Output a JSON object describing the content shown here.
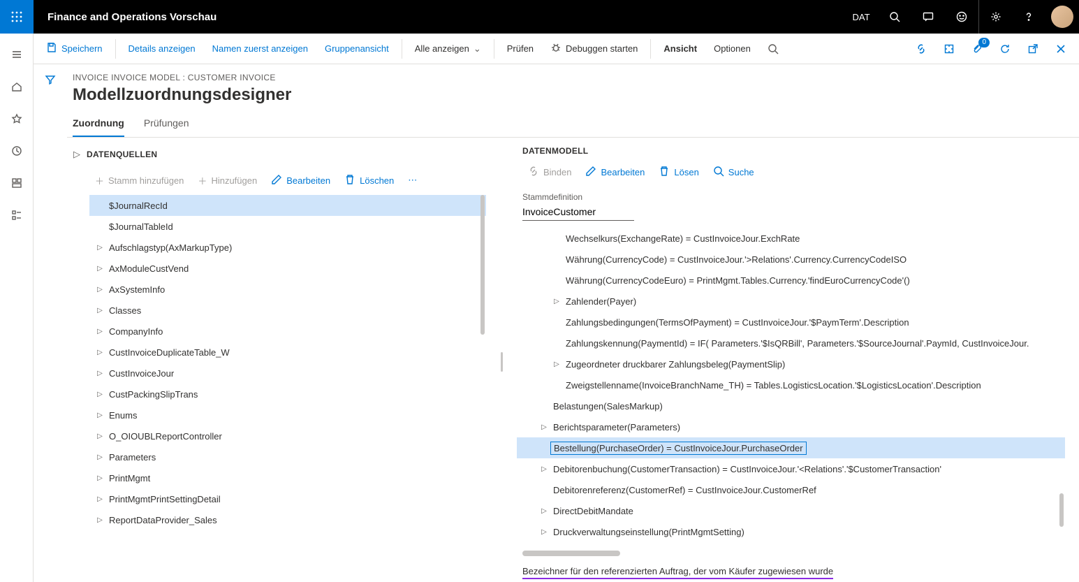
{
  "topbar": {
    "app_title": "Finance and Operations Vorschau",
    "company": "DAT"
  },
  "cmdbar": {
    "save": "Speichern",
    "details": "Details anzeigen",
    "names_first": "Namen zuerst anzeigen",
    "group_view": "Gruppenansicht",
    "show_all": "Alle anzeigen",
    "check": "Prüfen",
    "debug": "Debuggen starten",
    "view": "Ansicht",
    "options": "Optionen",
    "badge_count": "0"
  },
  "page": {
    "breadcrumb": "INVOICE INVOICE MODEL : CUSTOMER INVOICE",
    "title": "Modellzuordnungsdesigner",
    "tab_map": "Zuordnung",
    "tab_check": "Prüfungen"
  },
  "ds": {
    "header": "DATENQUELLEN",
    "add_root": "Stamm hinzufügen",
    "add": "Hinzufügen",
    "edit": "Bearbeiten",
    "delete": "Löschen",
    "items": [
      {
        "label": "$JournalRecId",
        "exp": false,
        "sel": true
      },
      {
        "label": "$JournalTableId",
        "exp": false,
        "sel": false
      },
      {
        "label": "Aufschlagstyp(AxMarkupType)",
        "exp": true,
        "sel": false
      },
      {
        "label": "AxModuleCustVend",
        "exp": true,
        "sel": false
      },
      {
        "label": "AxSystemInfo",
        "exp": true,
        "sel": false
      },
      {
        "label": "Classes",
        "exp": true,
        "sel": false
      },
      {
        "label": "CompanyInfo",
        "exp": true,
        "sel": false
      },
      {
        "label": "CustInvoiceDuplicateTable_W",
        "exp": true,
        "sel": false
      },
      {
        "label": "CustInvoiceJour",
        "exp": true,
        "sel": false
      },
      {
        "label": "CustPackingSlipTrans",
        "exp": true,
        "sel": false
      },
      {
        "label": "Enums",
        "exp": true,
        "sel": false
      },
      {
        "label": "O_OIOUBLReportController",
        "exp": true,
        "sel": false
      },
      {
        "label": "Parameters",
        "exp": true,
        "sel": false
      },
      {
        "label": "PrintMgmt",
        "exp": true,
        "sel": false
      },
      {
        "label": "PrintMgmtPrintSettingDetail",
        "exp": true,
        "sel": false
      },
      {
        "label": "ReportDataProvider_Sales",
        "exp": true,
        "sel": false
      }
    ]
  },
  "dm": {
    "header": "DATENMODELL",
    "bind": "Binden",
    "edit": "Bearbeiten",
    "delete": "Lösen",
    "search": "Suche",
    "root_label": "Stammdefinition",
    "root_value": "InvoiceCustomer",
    "items": [
      {
        "label": "Wechselkurs(ExchangeRate) = CustInvoiceJour.ExchRate",
        "exp": false,
        "ind": 1,
        "sel": false
      },
      {
        "label": "Währung(CurrencyCode) = CustInvoiceJour.'>Relations'.Currency.CurrencyCodeISO",
        "exp": false,
        "ind": 1,
        "sel": false
      },
      {
        "label": "Währung(CurrencyCodeEuro) = PrintMgmt.Tables.Currency.'findEuroCurrencyCode'()",
        "exp": false,
        "ind": 1,
        "sel": false
      },
      {
        "label": "Zahlender(Payer)",
        "exp": true,
        "ind": 1,
        "sel": false
      },
      {
        "label": "Zahlungsbedingungen(TermsOfPayment) = CustInvoiceJour.'$PaymTerm'.Description",
        "exp": false,
        "ind": 1,
        "sel": false
      },
      {
        "label": "Zahlungskennung(PaymentId) = IF( Parameters.'$IsQRBill', Parameters.'$SourceJournal'.PaymId, CustInvoiceJour.",
        "exp": false,
        "ind": 1,
        "sel": false
      },
      {
        "label": "Zugeordneter druckbarer Zahlungsbeleg(PaymentSlip)",
        "exp": true,
        "ind": 1,
        "sel": false
      },
      {
        "label": "Zweigstellenname(InvoiceBranchName_TH) = Tables.LogisticsLocation.'$LogisticsLocation'.Description",
        "exp": false,
        "ind": 1,
        "sel": false
      },
      {
        "label": "Belastungen(SalesMarkup)",
        "exp": false,
        "ind": 0,
        "sel": false
      },
      {
        "label": "Berichtsparameter(Parameters)",
        "exp": true,
        "ind": 0,
        "sel": false
      },
      {
        "label": "Bestellung(PurchaseOrder) = CustInvoiceJour.PurchaseOrder",
        "exp": false,
        "ind": 0,
        "sel": true
      },
      {
        "label": "Debitorenbuchung(CustomerTransaction) = CustInvoiceJour.'<Relations'.'$CustomerTransaction'",
        "exp": true,
        "ind": 0,
        "sel": false
      },
      {
        "label": "Debitorenreferenz(CustomerRef) = CustInvoiceJour.CustomerRef",
        "exp": false,
        "ind": 0,
        "sel": false
      },
      {
        "label": "DirectDebitMandate",
        "exp": true,
        "ind": 0,
        "sel": false
      },
      {
        "label": "Druckverwaltungseinstellung(PrintMgmtSetting)",
        "exp": true,
        "ind": 0,
        "sel": false
      }
    ],
    "footer": "Bezeichner für den referenzierten Auftrag, der vom Käufer zugewiesen wurde"
  }
}
